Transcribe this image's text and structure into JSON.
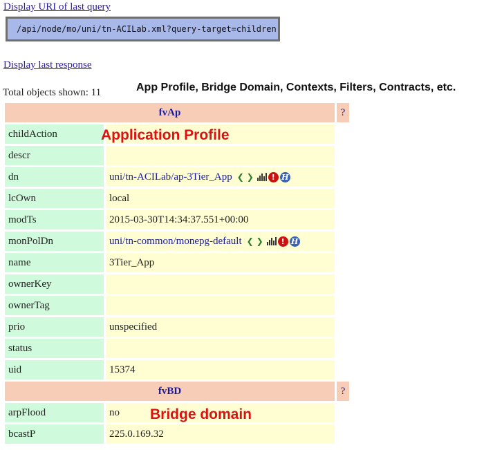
{
  "links": {
    "display_uri": "Display URI of last query",
    "display_response": "Display last response"
  },
  "uri": "/api/node/mo/uni/tn-ACILab.xml?query-target=children",
  "total_objects": "Total objects shown: 11",
  "annotations": {
    "top": "App Profile, Bridge Domain, Contexts, Filters, Contracts, etc.",
    "app_profile": "Application Profile",
    "bridge_domain": "Bridge domain"
  },
  "objects": [
    {
      "class": "fvAp",
      "help": "?",
      "rows": [
        {
          "prop": "childAction",
          "value": ""
        },
        {
          "prop": "descr",
          "value": ""
        },
        {
          "prop": "dn",
          "value": "uni/tn-ACILab/ap-3Tier_App",
          "link": true
        },
        {
          "prop": "lcOwn",
          "value": "local"
        },
        {
          "prop": "modTs",
          "value": "2015-03-30T14:34:37.551+00:00"
        },
        {
          "prop": "monPolDn",
          "value": "uni/tn-common/monepg-default",
          "link": true
        },
        {
          "prop": "name",
          "value": "3Tier_App"
        },
        {
          "prop": "ownerKey",
          "value": ""
        },
        {
          "prop": "ownerTag",
          "value": ""
        },
        {
          "prop": "prio",
          "value": "unspecified"
        },
        {
          "prop": "status",
          "value": ""
        },
        {
          "prop": "uid",
          "value": "15374"
        }
      ]
    },
    {
      "class": "fvBD",
      "help": "?",
      "rows": [
        {
          "prop": "arpFlood",
          "value": "no"
        },
        {
          "prop": "bcastP",
          "value": "225.0.169.32"
        }
      ]
    }
  ],
  "icons": {
    "prev": "chevron-left-icon",
    "next": "chevron-right-icon",
    "stats": "stats-bar-chart-icon",
    "faults": "fault-alert-icon",
    "health": "health-icon",
    "fault_glyph": "!",
    "health_glyph": "H",
    "chevron_left_glyph": "❮",
    "chevron_right_glyph": "❯"
  }
}
